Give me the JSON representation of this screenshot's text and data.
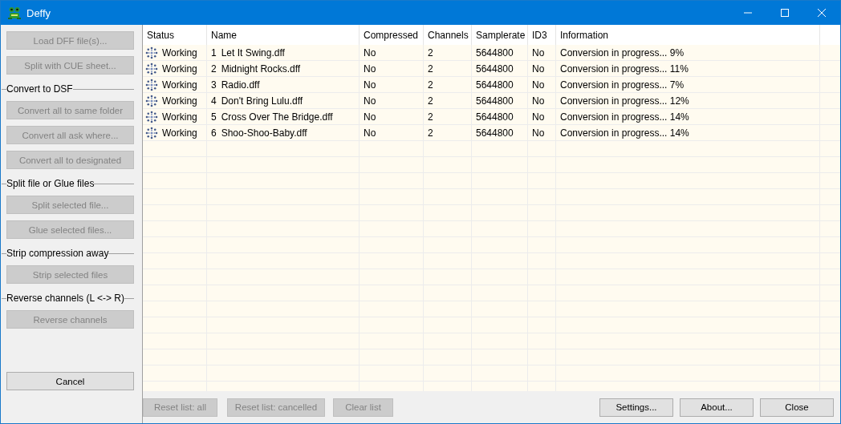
{
  "window": {
    "title": "Deffy"
  },
  "left_panel": [
    {
      "kind": "button",
      "label": "Load DFF file(s)...",
      "disabled": true
    },
    {
      "kind": "button",
      "label": "Split with CUE sheet...",
      "disabled": true
    },
    {
      "kind": "section",
      "label": "Convert to DSF"
    },
    {
      "kind": "button",
      "label": "Convert all to same folder",
      "disabled": true
    },
    {
      "kind": "button",
      "label": "Convert all ask where...",
      "disabled": true
    },
    {
      "kind": "button",
      "label": "Convert all to designated",
      "disabled": true
    },
    {
      "kind": "section",
      "label": "Split file or Glue files"
    },
    {
      "kind": "button",
      "label": "Split selected file...",
      "disabled": true
    },
    {
      "kind": "button",
      "label": "Glue selected files...",
      "disabled": true
    },
    {
      "kind": "section",
      "label": "Strip compression away"
    },
    {
      "kind": "button",
      "label": "Strip selected files",
      "disabled": true
    },
    {
      "kind": "section",
      "label": "Reverse channels (L <-> R)"
    },
    {
      "kind": "button",
      "label": "Reverse channels",
      "disabled": true
    }
  ],
  "cancel_button": {
    "label": "Cancel",
    "disabled": false
  },
  "table": {
    "columns": [
      "Status",
      "Name",
      "Compressed",
      "Channels",
      "Samplerate",
      "ID3",
      "Information"
    ],
    "rows": [
      {
        "status": "Working",
        "number": "1",
        "name": "Let It Swing.dff",
        "compressed": "No",
        "channels": "2",
        "samplerate": "5644800",
        "id3": "No",
        "information": "Conversion in progress... 9%"
      },
      {
        "status": "Working",
        "number": "2",
        "name": "Midnight Rocks.dff",
        "compressed": "No",
        "channels": "2",
        "samplerate": "5644800",
        "id3": "No",
        "information": "Conversion in progress... 11%"
      },
      {
        "status": "Working",
        "number": "3",
        "name": "Radio.dff",
        "compressed": "No",
        "channels": "2",
        "samplerate": "5644800",
        "id3": "No",
        "information": "Conversion in progress... 7%"
      },
      {
        "status": "Working",
        "number": "4",
        "name": "Don't Bring Lulu.dff",
        "compressed": "No",
        "channels": "2",
        "samplerate": "5644800",
        "id3": "No",
        "information": "Conversion in progress... 12%"
      },
      {
        "status": "Working",
        "number": "5",
        "name": "Cross Over The Bridge.dff",
        "compressed": "No",
        "channels": "2",
        "samplerate": "5644800",
        "id3": "No",
        "information": "Conversion in progress... 14%"
      },
      {
        "status": "Working",
        "number": "6",
        "name": "Shoo-Shoo-Baby.dff",
        "compressed": "No",
        "channels": "2",
        "samplerate": "5644800",
        "id3": "No",
        "information": "Conversion in progress... 14%"
      }
    ]
  },
  "bottom_left_buttons": [
    {
      "label": "Reset list: all",
      "disabled": true
    },
    {
      "label": "Reset list: cancelled",
      "disabled": true
    },
    {
      "label": "Clear list",
      "disabled": true
    }
  ],
  "bottom_right_buttons": [
    {
      "label": "Settings...",
      "disabled": false
    },
    {
      "label": "About...",
      "disabled": false
    },
    {
      "label": "Close",
      "disabled": false
    }
  ]
}
